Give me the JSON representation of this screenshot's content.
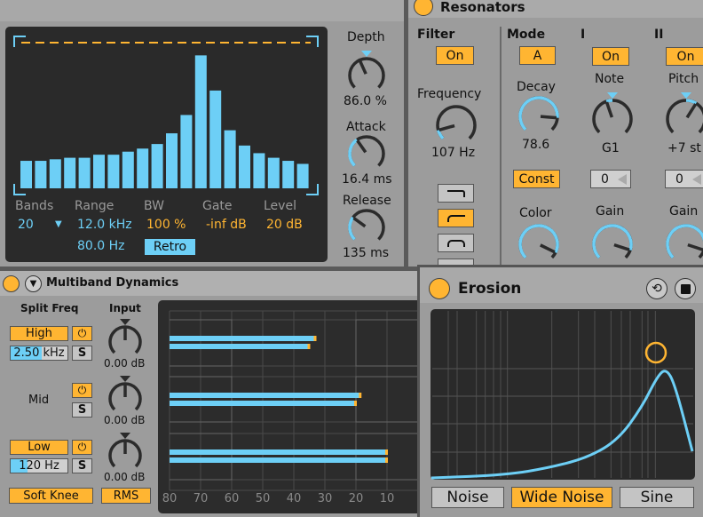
{
  "colors": {
    "accent_blue": "#6dcff6",
    "accent_orange": "#ffb532",
    "panel": "#9c9c9c",
    "display": "#2a2a2a"
  },
  "vocoder": {
    "bands_levels": [
      0.18,
      0.18,
      0.19,
      0.2,
      0.2,
      0.22,
      0.22,
      0.24,
      0.26,
      0.29,
      0.36,
      0.48,
      0.87,
      0.64,
      0.38,
      0.28,
      0.23,
      0.2,
      0.18,
      0.16
    ],
    "labels": {
      "bands": "Bands",
      "range": "Range",
      "bw": "BW",
      "gate": "Gate",
      "level": "Level"
    },
    "values": {
      "bands": "20",
      "range_high": "12.0 kHz",
      "range_low": "80.0 Hz",
      "bw": "100 %",
      "gate": "-inf dB",
      "level": "20 dB"
    },
    "retro_label": "Retro",
    "knobs": {
      "depth": {
        "label": "Depth",
        "value": "86.0 %",
        "position": 0.41
      },
      "attack": {
        "label": "Attack",
        "value": "16.4 ms",
        "position": 0.37
      },
      "release": {
        "label": "Release",
        "value": "135 ms",
        "position": 0.3
      }
    }
  },
  "resonators": {
    "title": "Resonators",
    "filter": {
      "label": "Filter",
      "on_label": "On",
      "frequency_label": "Frequency",
      "frequency_value": "107 Hz",
      "frequency_position": 0.11
    },
    "mode": {
      "label": "Mode",
      "value": "A"
    },
    "decay": {
      "label": "Decay",
      "value": "78.6",
      "position": 0.85
    },
    "const_label": "Const",
    "color_label": "Color",
    "color_position": 0.93,
    "voice1": {
      "label": "I",
      "on_label": "On",
      "note_label": "Note",
      "note_value": "G1",
      "note_position": 0.43,
      "fine": "0",
      "gain_label": "Gain",
      "gain_position": 0.9
    },
    "voice2": {
      "label": "II",
      "on_label": "On",
      "pitch_label": "Pitch",
      "pitch_value": "+7 st",
      "pitch_position": 0.62,
      "fine": "0",
      "gain_label": "Gain",
      "gain_position": 0.9
    }
  },
  "multiband": {
    "title": "Multiband Dynamics",
    "split_freq_label": "Split Freq",
    "input_label": "Input",
    "bands": [
      {
        "name": "High",
        "freq": "2.50 kHz",
        "freq_fill": 0.55,
        "input": "0.00 dB",
        "meter": [
          33,
          35
        ]
      },
      {
        "name": "Mid",
        "freq": "",
        "input": "0.00 dB",
        "meter": [
          18.5,
          20
        ]
      },
      {
        "name": "Low",
        "freq": "120 Hz",
        "freq_fill": 0.3,
        "input": "0.00 dB",
        "meter": [
          10,
          10
        ]
      }
    ],
    "solo_label": "S",
    "soft_knee_label": "Soft Knee",
    "rms_label": "RMS",
    "axis_ticks": [
      "80",
      "70",
      "60",
      "50",
      "40",
      "30",
      "20",
      "10"
    ]
  },
  "erosion": {
    "title": "Erosion",
    "modes": [
      "Noise",
      "Wide Noise",
      "Sine"
    ],
    "selected_mode": "Wide Noise"
  }
}
